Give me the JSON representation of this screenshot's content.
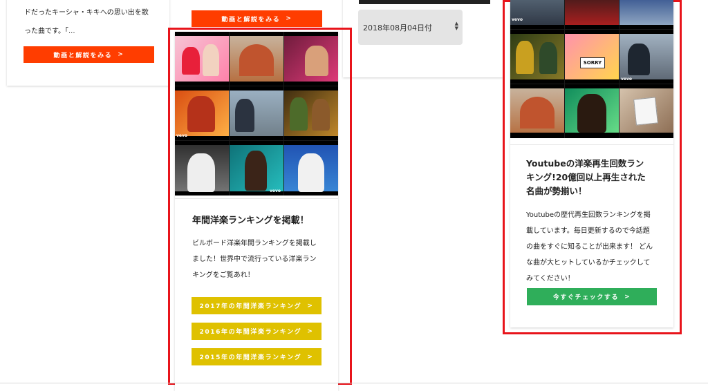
{
  "left_card": {
    "text_line1": "ドだったキーシャ・キキへの思い出を歌",
    "text_line2": "った曲です。「...",
    "button": "動画と解説をみる"
  },
  "center_top": {
    "button": "動画と解説をみる"
  },
  "date_select": {
    "value": "2018年08月04日付"
  },
  "ranking_card": {
    "title": "年間洋楽ランキングを掲載！",
    "desc_lines": [
      "ビルボード洋楽年間ランキングを掲載し",
      "ました！世界中で流行っている洋楽ラン",
      "キングをご覧あれ！"
    ],
    "buttons": [
      "2017年の年間洋楽ランキング",
      "2016年の年間洋楽ランキング",
      "2015年の年間洋楽ランキング"
    ],
    "thumb_labels": [
      "vevo",
      "vevo"
    ]
  },
  "youtube_card": {
    "title_lines": [
      "Youtubeの洋楽再生回数ラン",
      "キング!20億回以上再生された",
      "名曲が勢揃い！"
    ],
    "desc_lines": [
      "Youtubeの歴代再生回数ランキングを掲",
      "載しています。毎日更新するので今話題",
      "の曲をすぐに知ることが出来ます！ どん",
      "な曲が大ヒットしているかチェックして",
      "みてください！"
    ],
    "button": "今すぐチェックする",
    "thumb_labels": [
      "vevo",
      "vevo",
      "SORRY"
    ]
  },
  "chevron": ">",
  "colors": {
    "red_button": "#ff3d00",
    "yellow_button": "#dfc100",
    "green_button": "#2fae5a",
    "highlight_box": "#e8141b"
  }
}
